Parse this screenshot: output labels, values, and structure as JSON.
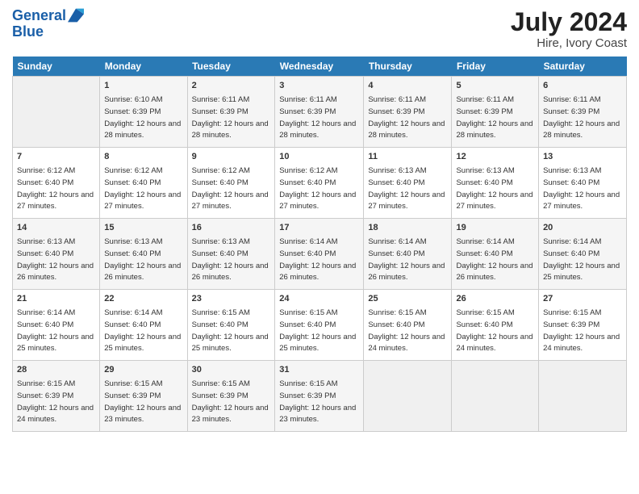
{
  "header": {
    "logo_line1": "General",
    "logo_line2": "Blue",
    "month_year": "July 2024",
    "location": "Hire, Ivory Coast"
  },
  "days_of_week": [
    "Sunday",
    "Monday",
    "Tuesday",
    "Wednesday",
    "Thursday",
    "Friday",
    "Saturday"
  ],
  "weeks": [
    [
      {
        "day": "",
        "sunrise": "",
        "sunset": "",
        "daylight": ""
      },
      {
        "day": "1",
        "sunrise": "Sunrise: 6:10 AM",
        "sunset": "Sunset: 6:39 PM",
        "daylight": "Daylight: 12 hours and 28 minutes."
      },
      {
        "day": "2",
        "sunrise": "Sunrise: 6:11 AM",
        "sunset": "Sunset: 6:39 PM",
        "daylight": "Daylight: 12 hours and 28 minutes."
      },
      {
        "day": "3",
        "sunrise": "Sunrise: 6:11 AM",
        "sunset": "Sunset: 6:39 PM",
        "daylight": "Daylight: 12 hours and 28 minutes."
      },
      {
        "day": "4",
        "sunrise": "Sunrise: 6:11 AM",
        "sunset": "Sunset: 6:39 PM",
        "daylight": "Daylight: 12 hours and 28 minutes."
      },
      {
        "day": "5",
        "sunrise": "Sunrise: 6:11 AM",
        "sunset": "Sunset: 6:39 PM",
        "daylight": "Daylight: 12 hours and 28 minutes."
      },
      {
        "day": "6",
        "sunrise": "Sunrise: 6:11 AM",
        "sunset": "Sunset: 6:39 PM",
        "daylight": "Daylight: 12 hours and 28 minutes."
      }
    ],
    [
      {
        "day": "7",
        "sunrise": "Sunrise: 6:12 AM",
        "sunset": "Sunset: 6:40 PM",
        "daylight": "Daylight: 12 hours and 27 minutes."
      },
      {
        "day": "8",
        "sunrise": "Sunrise: 6:12 AM",
        "sunset": "Sunset: 6:40 PM",
        "daylight": "Daylight: 12 hours and 27 minutes."
      },
      {
        "day": "9",
        "sunrise": "Sunrise: 6:12 AM",
        "sunset": "Sunset: 6:40 PM",
        "daylight": "Daylight: 12 hours and 27 minutes."
      },
      {
        "day": "10",
        "sunrise": "Sunrise: 6:12 AM",
        "sunset": "Sunset: 6:40 PM",
        "daylight": "Daylight: 12 hours and 27 minutes."
      },
      {
        "day": "11",
        "sunrise": "Sunrise: 6:13 AM",
        "sunset": "Sunset: 6:40 PM",
        "daylight": "Daylight: 12 hours and 27 minutes."
      },
      {
        "day": "12",
        "sunrise": "Sunrise: 6:13 AM",
        "sunset": "Sunset: 6:40 PM",
        "daylight": "Daylight: 12 hours and 27 minutes."
      },
      {
        "day": "13",
        "sunrise": "Sunrise: 6:13 AM",
        "sunset": "Sunset: 6:40 PM",
        "daylight": "Daylight: 12 hours and 27 minutes."
      }
    ],
    [
      {
        "day": "14",
        "sunrise": "Sunrise: 6:13 AM",
        "sunset": "Sunset: 6:40 PM",
        "daylight": "Daylight: 12 hours and 26 minutes."
      },
      {
        "day": "15",
        "sunrise": "Sunrise: 6:13 AM",
        "sunset": "Sunset: 6:40 PM",
        "daylight": "Daylight: 12 hours and 26 minutes."
      },
      {
        "day": "16",
        "sunrise": "Sunrise: 6:13 AM",
        "sunset": "Sunset: 6:40 PM",
        "daylight": "Daylight: 12 hours and 26 minutes."
      },
      {
        "day": "17",
        "sunrise": "Sunrise: 6:14 AM",
        "sunset": "Sunset: 6:40 PM",
        "daylight": "Daylight: 12 hours and 26 minutes."
      },
      {
        "day": "18",
        "sunrise": "Sunrise: 6:14 AM",
        "sunset": "Sunset: 6:40 PM",
        "daylight": "Daylight: 12 hours and 26 minutes."
      },
      {
        "day": "19",
        "sunrise": "Sunrise: 6:14 AM",
        "sunset": "Sunset: 6:40 PM",
        "daylight": "Daylight: 12 hours and 26 minutes."
      },
      {
        "day": "20",
        "sunrise": "Sunrise: 6:14 AM",
        "sunset": "Sunset: 6:40 PM",
        "daylight": "Daylight: 12 hours and 25 minutes."
      }
    ],
    [
      {
        "day": "21",
        "sunrise": "Sunrise: 6:14 AM",
        "sunset": "Sunset: 6:40 PM",
        "daylight": "Daylight: 12 hours and 25 minutes."
      },
      {
        "day": "22",
        "sunrise": "Sunrise: 6:14 AM",
        "sunset": "Sunset: 6:40 PM",
        "daylight": "Daylight: 12 hours and 25 minutes."
      },
      {
        "day": "23",
        "sunrise": "Sunrise: 6:15 AM",
        "sunset": "Sunset: 6:40 PM",
        "daylight": "Daylight: 12 hours and 25 minutes."
      },
      {
        "day": "24",
        "sunrise": "Sunrise: 6:15 AM",
        "sunset": "Sunset: 6:40 PM",
        "daylight": "Daylight: 12 hours and 25 minutes."
      },
      {
        "day": "25",
        "sunrise": "Sunrise: 6:15 AM",
        "sunset": "Sunset: 6:40 PM",
        "daylight": "Daylight: 12 hours and 24 minutes."
      },
      {
        "day": "26",
        "sunrise": "Sunrise: 6:15 AM",
        "sunset": "Sunset: 6:40 PM",
        "daylight": "Daylight: 12 hours and 24 minutes."
      },
      {
        "day": "27",
        "sunrise": "Sunrise: 6:15 AM",
        "sunset": "Sunset: 6:39 PM",
        "daylight": "Daylight: 12 hours and 24 minutes."
      }
    ],
    [
      {
        "day": "28",
        "sunrise": "Sunrise: 6:15 AM",
        "sunset": "Sunset: 6:39 PM",
        "daylight": "Daylight: 12 hours and 24 minutes."
      },
      {
        "day": "29",
        "sunrise": "Sunrise: 6:15 AM",
        "sunset": "Sunset: 6:39 PM",
        "daylight": "Daylight: 12 hours and 23 minutes."
      },
      {
        "day": "30",
        "sunrise": "Sunrise: 6:15 AM",
        "sunset": "Sunset: 6:39 PM",
        "daylight": "Daylight: 12 hours and 23 minutes."
      },
      {
        "day": "31",
        "sunrise": "Sunrise: 6:15 AM",
        "sunset": "Sunset: 6:39 PM",
        "daylight": "Daylight: 12 hours and 23 minutes."
      },
      {
        "day": "",
        "sunrise": "",
        "sunset": "",
        "daylight": ""
      },
      {
        "day": "",
        "sunrise": "",
        "sunset": "",
        "daylight": ""
      },
      {
        "day": "",
        "sunrise": "",
        "sunset": "",
        "daylight": ""
      }
    ]
  ]
}
